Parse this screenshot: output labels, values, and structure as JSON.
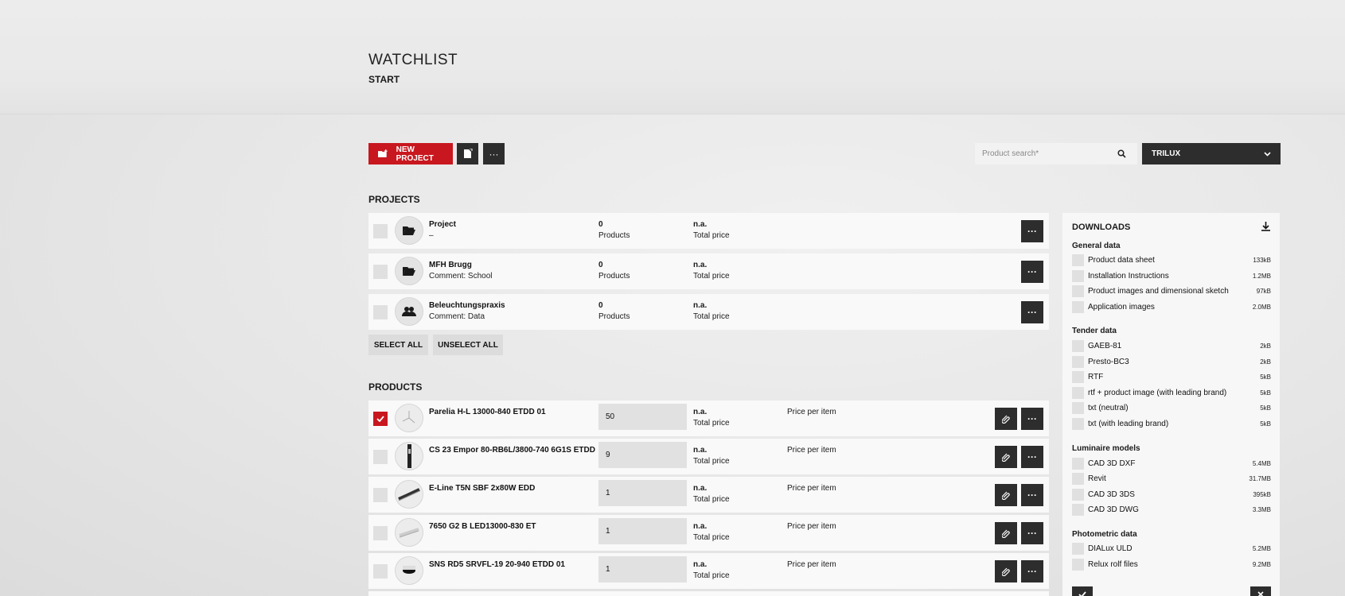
{
  "header": {
    "title": "WATCHLIST",
    "breadcrumb": "START"
  },
  "toolbar": {
    "new_project_label": "NEW PROJECT",
    "more_label": "···",
    "search_placeholder": "Product search*",
    "brand_selected": "TRILUX"
  },
  "projects": {
    "title": "PROJECTS",
    "items": [
      {
        "name": "Project",
        "comment": "–",
        "count": "0",
        "count_label": "Products",
        "price": "n.a.",
        "price_label": "Total price",
        "icon": "folder-open-icon"
      },
      {
        "name": "MFH Brugg",
        "comment": "Comment: School",
        "count": "0",
        "count_label": "Products",
        "price": "n.a.",
        "price_label": "Total price",
        "icon": "folder-open-icon"
      },
      {
        "name": "Beleuchtungspraxis",
        "comment": "Comment: Data",
        "count": "0",
        "count_label": "Products",
        "price": "n.a.",
        "price_label": "Total price",
        "icon": "users-icon"
      }
    ],
    "select_all": "SELECT ALL",
    "unselect_all": "UNSELECT ALL"
  },
  "products": {
    "title": "PRODUCTS",
    "items": [
      {
        "name": "Parelia H-L 13000-840 ETDD 01",
        "qty": "50",
        "price": "n.a.",
        "price_label": "Total price",
        "ppi": "Price per item",
        "checked": true
      },
      {
        "name": "CS 23 Empor 80-RB6L/3800-740 6G1S ETDD",
        "qty": "9",
        "price": "n.a.",
        "price_label": "Total price",
        "ppi": "Price per item",
        "checked": false
      },
      {
        "name": "E-Line T5N SBF 2x80W EDD",
        "qty": "1",
        "price": "n.a.",
        "price_label": "Total price",
        "ppi": "Price per item",
        "checked": false
      },
      {
        "name": "7650 G2 B LED13000-830 ET",
        "qty": "1",
        "price": "n.a.",
        "price_label": "Total price",
        "ppi": "Price per item",
        "checked": false
      },
      {
        "name": "SNS RD5 SRVFL-19 20-940 ETDD 01",
        "qty": "1",
        "price": "n.a.",
        "price_label": "Total price",
        "ppi": "Price per item",
        "checked": false
      }
    ]
  },
  "downloads": {
    "title": "DOWNLOADS",
    "groups": [
      {
        "title": "General data",
        "items": [
          {
            "label": "Product data sheet",
            "size": "133kB"
          },
          {
            "label": "Installation Instructions",
            "size": "1.2MB"
          },
          {
            "label": "Product images and dimensional sketch",
            "size": "97kB"
          },
          {
            "label": "Application images",
            "size": "2.0MB"
          }
        ]
      },
      {
        "title": "Tender data",
        "items": [
          {
            "label": "GAEB-81",
            "size": "2kB"
          },
          {
            "label": "Presto-BC3",
            "size": "2kB"
          },
          {
            "label": "RTF",
            "size": "5kB"
          },
          {
            "label": "rtf + product image (with leading brand)",
            "size": "5kB"
          },
          {
            "label": "txt (neutral)",
            "size": "5kB"
          },
          {
            "label": "txt (with leading brand)",
            "size": "5kB"
          }
        ]
      },
      {
        "title": "Luminaire models",
        "items": [
          {
            "label": "CAD 3D DXF",
            "size": "5.4MB"
          },
          {
            "label": "Revit",
            "size": "31.7MB"
          },
          {
            "label": "CAD 3D 3DS",
            "size": "395kB"
          },
          {
            "label": "CAD 3D DWG",
            "size": "3.3MB"
          }
        ]
      },
      {
        "title": "Photometric data",
        "items": [
          {
            "label": "DIALux ULD",
            "size": "5.2MB"
          },
          {
            "label": "Relux rolf files",
            "size": "9.2MB"
          }
        ]
      }
    ]
  },
  "colors": {
    "accent": "#c8171e",
    "dark": "#2d2d2d"
  }
}
